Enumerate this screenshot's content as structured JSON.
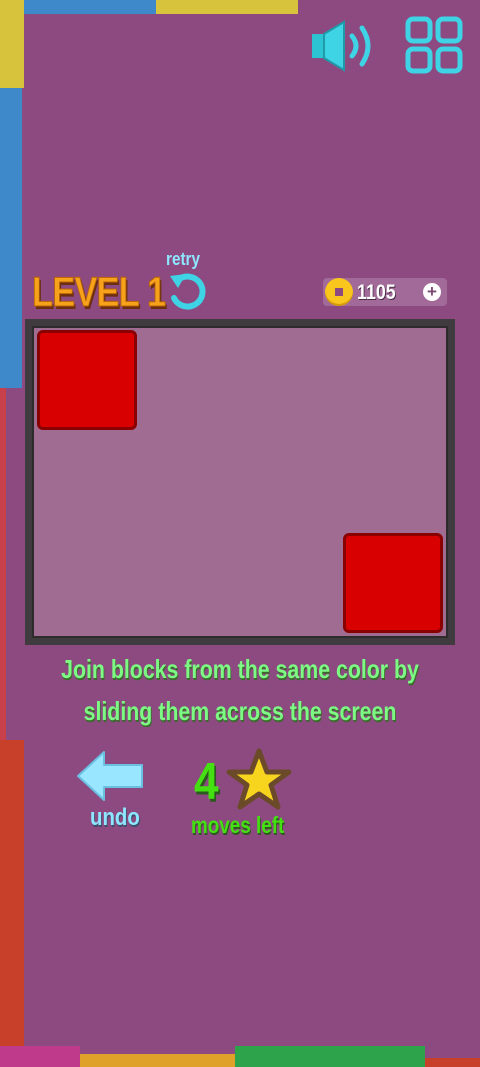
{
  "colors": {
    "background": "#8c4a80",
    "block": "#d80000",
    "board": "#a06c92",
    "accent_cyan": "#3fd3e6",
    "level_orange": "#f7a21b",
    "text_green": "#7dfa84",
    "moves_green": "#44e011"
  },
  "header": {
    "sound_icon": "speaker-icon",
    "menu_icon": "grid-icon"
  },
  "level": {
    "title": "LEVEL 1",
    "retry_label": "retry"
  },
  "coins": {
    "count": "1105",
    "add_symbol": "+"
  },
  "board": {
    "blocks": [
      {
        "color": "red",
        "cell": "top-left"
      },
      {
        "color": "red",
        "cell": "bottom-right"
      }
    ]
  },
  "instruction": "Join blocks from the same color by sliding them across the screen",
  "controls": {
    "undo_label": "undo",
    "moves_count": "4",
    "moves_label": "moves left",
    "star_icon": "star-icon"
  }
}
